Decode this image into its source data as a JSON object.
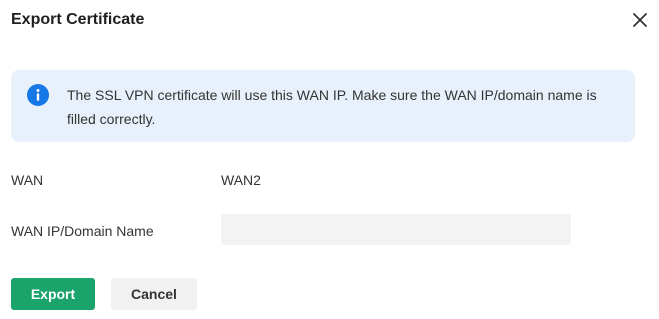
{
  "dialog": {
    "title": "Export Certificate",
    "close_icon": "close-icon"
  },
  "info": {
    "icon": "info-icon",
    "message": "The SSL VPN certificate will use this WAN IP. Make sure the WAN IP/domain name is filled correctly."
  },
  "form": {
    "wan_label": "WAN",
    "wan_value": "WAN2",
    "domain_label": "WAN IP/Domain Name",
    "domain_value": "",
    "domain_placeholder": ""
  },
  "buttons": {
    "export_label": "Export",
    "cancel_label": "Cancel"
  },
  "colors": {
    "primary": "#1aa36b",
    "info_bg": "#e8f1fb",
    "info_icon": "#1677e6"
  }
}
